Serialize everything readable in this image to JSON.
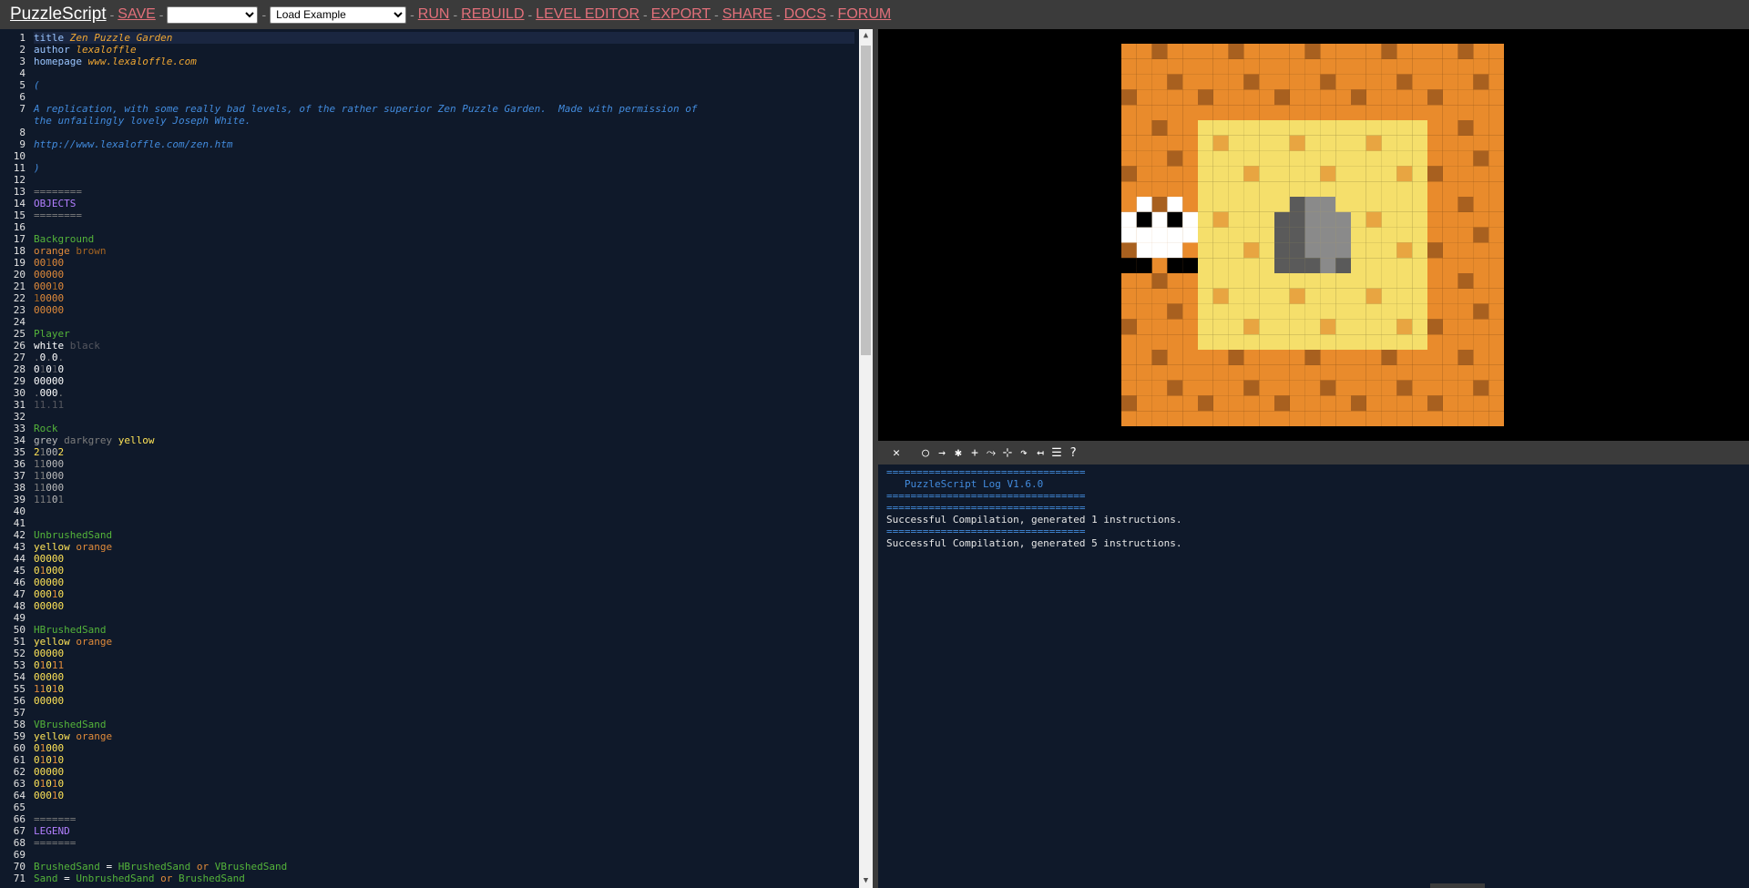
{
  "header": {
    "brand": "PuzzleScript",
    "save_label": "SAVE",
    "save_select_value": "",
    "example_select_value": "Load Example",
    "links": [
      "RUN",
      "REBUILD",
      "LEVEL EDITOR",
      "EXPORT",
      "SHARE",
      "DOCS",
      "FORUM"
    ]
  },
  "editor": {
    "lines": [
      {
        "n": "1",
        "tokens": [
          [
            "kw",
            "title "
          ],
          [
            "title",
            "Zen Puzzle Garden"
          ]
        ]
      },
      {
        "n": "2",
        "tokens": [
          [
            "kw",
            "author "
          ],
          [
            "title",
            "lexaloffle"
          ]
        ]
      },
      {
        "n": "3",
        "tokens": [
          [
            "kw",
            "homepage "
          ],
          [
            "title",
            "www.lexaloffle.com"
          ]
        ]
      },
      {
        "n": "4",
        "tokens": []
      },
      {
        "n": "5",
        "tokens": [
          [
            "comment",
            "("
          ]
        ]
      },
      {
        "n": "6",
        "tokens": []
      },
      {
        "n": "7",
        "tokens": [
          [
            "comment",
            "A replication, with some really bad levels, of the rather superior Zen Puzzle Garden.  Made with permission of"
          ]
        ]
      },
      {
        "n": "",
        "tokens": [
          [
            "comment",
            "the unfailingly lovely Joseph White."
          ]
        ]
      },
      {
        "n": "8",
        "tokens": []
      },
      {
        "n": "9",
        "tokens": [
          [
            "comment",
            "http://www.lexaloffle.com/zen.htm"
          ]
        ]
      },
      {
        "n": "10",
        "tokens": []
      },
      {
        "n": "11",
        "tokens": [
          [
            "comment",
            ")"
          ]
        ]
      },
      {
        "n": "12",
        "tokens": []
      },
      {
        "n": "13",
        "tokens": [
          [
            "sep",
            "========"
          ]
        ]
      },
      {
        "n": "14",
        "tokens": [
          [
            "header",
            "OBJECTS"
          ]
        ]
      },
      {
        "n": "15",
        "tokens": [
          [
            "sep",
            "========"
          ]
        ]
      },
      {
        "n": "16",
        "tokens": []
      },
      {
        "n": "17",
        "tokens": [
          [
            "name",
            "Background"
          ]
        ]
      },
      {
        "n": "18",
        "tokens": [
          [
            "orange",
            "orange "
          ],
          [
            "brown",
            "brown"
          ]
        ]
      },
      {
        "n": "19",
        "tokens": [
          [
            "orange",
            "00"
          ],
          [
            "brown",
            "1"
          ],
          [
            "orange",
            "00"
          ]
        ]
      },
      {
        "n": "20",
        "tokens": [
          [
            "orange",
            "00000"
          ]
        ]
      },
      {
        "n": "21",
        "tokens": [
          [
            "orange",
            "000"
          ],
          [
            "brown",
            "1"
          ],
          [
            "orange",
            "0"
          ]
        ]
      },
      {
        "n": "22",
        "tokens": [
          [
            "brown",
            "1"
          ],
          [
            "orange",
            "0000"
          ]
        ]
      },
      {
        "n": "23",
        "tokens": [
          [
            "orange",
            "00000"
          ]
        ]
      },
      {
        "n": "24",
        "tokens": []
      },
      {
        "n": "25",
        "tokens": [
          [
            "name",
            "Player"
          ]
        ]
      },
      {
        "n": "26",
        "tokens": [
          [
            "white",
            "white "
          ],
          [
            "black",
            "black"
          ]
        ]
      },
      {
        "n": "27",
        "tokens": [
          [
            "dgrey",
            "."
          ],
          [
            "white",
            "0"
          ],
          [
            "dgrey",
            "."
          ],
          [
            "white",
            "0"
          ],
          [
            "dgrey",
            "."
          ]
        ]
      },
      {
        "n": "28",
        "tokens": [
          [
            "white",
            "0"
          ],
          [
            "black",
            "1"
          ],
          [
            "white",
            "0"
          ],
          [
            "black",
            "1"
          ],
          [
            "white",
            "0"
          ]
        ]
      },
      {
        "n": "29",
        "tokens": [
          [
            "white",
            "00000"
          ]
        ]
      },
      {
        "n": "30",
        "tokens": [
          [
            "dgrey",
            "."
          ],
          [
            "white",
            "000"
          ],
          [
            "dgrey",
            "."
          ]
        ]
      },
      {
        "n": "31",
        "tokens": [
          [
            "black",
            "11.11"
          ]
        ]
      },
      {
        "n": "32",
        "tokens": []
      },
      {
        "n": "33",
        "tokens": [
          [
            "name",
            "Rock"
          ]
        ]
      },
      {
        "n": "34",
        "tokens": [
          [
            "grey",
            "grey "
          ],
          [
            "dgrey",
            "darkgrey "
          ],
          [
            "yellow",
            "yellow"
          ]
        ]
      },
      {
        "n": "35",
        "tokens": [
          [
            "yellow",
            "2"
          ],
          [
            "dgrey",
            "1"
          ],
          [
            "grey",
            "00"
          ],
          [
            "yellow",
            "2"
          ]
        ]
      },
      {
        "n": "36",
        "tokens": [
          [
            "dgrey",
            "11"
          ],
          [
            "grey",
            "000"
          ]
        ]
      },
      {
        "n": "37",
        "tokens": [
          [
            "dgrey",
            "11"
          ],
          [
            "grey",
            "000"
          ]
        ]
      },
      {
        "n": "38",
        "tokens": [
          [
            "dgrey",
            "11"
          ],
          [
            "grey",
            "000"
          ]
        ]
      },
      {
        "n": "39",
        "tokens": [
          [
            "dgrey",
            "111"
          ],
          [
            "grey",
            "0"
          ],
          [
            "dgrey",
            "1"
          ]
        ]
      },
      {
        "n": "40",
        "tokens": []
      },
      {
        "n": "41",
        "tokens": []
      },
      {
        "n": "42",
        "tokens": [
          [
            "name",
            "UnbrushedSand"
          ]
        ]
      },
      {
        "n": "43",
        "tokens": [
          [
            "yellow",
            "yellow "
          ],
          [
            "orange",
            "orange"
          ]
        ]
      },
      {
        "n": "44",
        "tokens": [
          [
            "yellow",
            "00000"
          ]
        ]
      },
      {
        "n": "45",
        "tokens": [
          [
            "yellow",
            "0"
          ],
          [
            "orange",
            "1"
          ],
          [
            "yellow",
            "000"
          ]
        ]
      },
      {
        "n": "46",
        "tokens": [
          [
            "yellow",
            "00000"
          ]
        ]
      },
      {
        "n": "47",
        "tokens": [
          [
            "yellow",
            "000"
          ],
          [
            "orange",
            "1"
          ],
          [
            "yellow",
            "0"
          ]
        ]
      },
      {
        "n": "48",
        "tokens": [
          [
            "yellow",
            "00000"
          ]
        ]
      },
      {
        "n": "49",
        "tokens": []
      },
      {
        "n": "50",
        "tokens": [
          [
            "name",
            "HBrushedSand"
          ]
        ]
      },
      {
        "n": "51",
        "tokens": [
          [
            "yellow",
            "yellow "
          ],
          [
            "orange",
            "orange"
          ]
        ]
      },
      {
        "n": "52",
        "tokens": [
          [
            "yellow",
            "00000"
          ]
        ]
      },
      {
        "n": "53",
        "tokens": [
          [
            "yellow",
            "0"
          ],
          [
            "orange",
            "1"
          ],
          [
            "yellow",
            "0"
          ],
          [
            "orange",
            "11"
          ]
        ]
      },
      {
        "n": "54",
        "tokens": [
          [
            "yellow",
            "00000"
          ]
        ]
      },
      {
        "n": "55",
        "tokens": [
          [
            "orange",
            "11"
          ],
          [
            "yellow",
            "0"
          ],
          [
            "orange",
            "1"
          ],
          [
            "yellow",
            "0"
          ]
        ]
      },
      {
        "n": "56",
        "tokens": [
          [
            "yellow",
            "00000"
          ]
        ]
      },
      {
        "n": "57",
        "tokens": []
      },
      {
        "n": "58",
        "tokens": [
          [
            "name",
            "VBrushedSand"
          ]
        ]
      },
      {
        "n": "59",
        "tokens": [
          [
            "yellow",
            "yellow "
          ],
          [
            "orange",
            "orange"
          ]
        ]
      },
      {
        "n": "60",
        "tokens": [
          [
            "yellow",
            "0"
          ],
          [
            "orange",
            "1"
          ],
          [
            "yellow",
            "000"
          ]
        ]
      },
      {
        "n": "61",
        "tokens": [
          [
            "yellow",
            "0"
          ],
          [
            "orange",
            "1"
          ],
          [
            "yellow",
            "0"
          ],
          [
            "orange",
            "1"
          ],
          [
            "yellow",
            "0"
          ]
        ]
      },
      {
        "n": "62",
        "tokens": [
          [
            "yellow",
            "00000"
          ]
        ]
      },
      {
        "n": "63",
        "tokens": [
          [
            "yellow",
            "0"
          ],
          [
            "orange",
            "1"
          ],
          [
            "yellow",
            "0"
          ],
          [
            "orange",
            "1"
          ],
          [
            "yellow",
            "0"
          ]
        ]
      },
      {
        "n": "64",
        "tokens": [
          [
            "yellow",
            "000"
          ],
          [
            "orange",
            "1"
          ],
          [
            "yellow",
            "0"
          ]
        ]
      },
      {
        "n": "65",
        "tokens": []
      },
      {
        "n": "66",
        "tokens": [
          [
            "sep",
            "======="
          ]
        ]
      },
      {
        "n": "67",
        "tokens": [
          [
            "header",
            "LEGEND"
          ]
        ]
      },
      {
        "n": "68",
        "tokens": [
          [
            "sep",
            "======="
          ]
        ]
      },
      {
        "n": "69",
        "tokens": []
      },
      {
        "n": "70",
        "tokens": [
          [
            "name",
            "BrushedSand"
          ],
          [
            "white",
            " = "
          ],
          [
            "name",
            "HBrushedSand"
          ],
          [
            "orange",
            " or "
          ],
          [
            "name",
            "VBrushedSand"
          ]
        ]
      },
      {
        "n": "71",
        "tokens": [
          [
            "name",
            "Sand"
          ],
          [
            "white",
            " = "
          ],
          [
            "name",
            "UnbrushedSand"
          ],
          [
            "orange",
            " or "
          ],
          [
            "name",
            "BrushedSand"
          ]
        ]
      }
    ]
  },
  "game": {
    "grid": [
      "BBBBB",
      "BSSSB",
      "PSRSB",
      "BSSSB",
      "BBBBB"
    ],
    "colors": {
      "orange": "#e98b2c",
      "brown": "#a8601f",
      "yellow": "#f5df6b",
      "sand_dot": "#e8a541",
      "grey": "#8a8a8a",
      "darkgrey": "#5a5a5a",
      "white": "#ffffff",
      "black": "#000000"
    }
  },
  "toolbar": {
    "buttons": [
      {
        "name": "close-icon",
        "glyph": "✕"
      },
      {
        "name": "circle-icon",
        "glyph": "○"
      },
      {
        "name": "arrow-right-icon",
        "glyph": "→"
      },
      {
        "name": "asterisk-icon",
        "glyph": "✱"
      },
      {
        "name": "plus-icon",
        "glyph": "+"
      },
      {
        "name": "movement-icon",
        "glyph": "⤳"
      },
      {
        "name": "compress-icon",
        "glyph": "⊹"
      },
      {
        "name": "redo-icon",
        "glyph": "↷"
      },
      {
        "name": "undo-icon",
        "glyph": "↤"
      },
      {
        "name": "list-icon",
        "glyph": "☰"
      },
      {
        "name": "help-icon",
        "glyph": "?"
      }
    ]
  },
  "console": {
    "lines": [
      {
        "text": "=================================",
        "style": "blue"
      },
      {
        "text": "   PuzzleScript Log V1.6.0",
        "style": "blue"
      },
      {
        "text": "=================================",
        "style": "blue"
      },
      {
        "text": "=================================",
        "style": "blue"
      },
      {
        "text": "Successful Compilation, generated 1 instructions.",
        "style": "normal"
      },
      {
        "text": "=================================",
        "style": "blue"
      },
      {
        "text": "Successful Compilation, generated 5 instructions.",
        "style": "normal"
      }
    ]
  }
}
